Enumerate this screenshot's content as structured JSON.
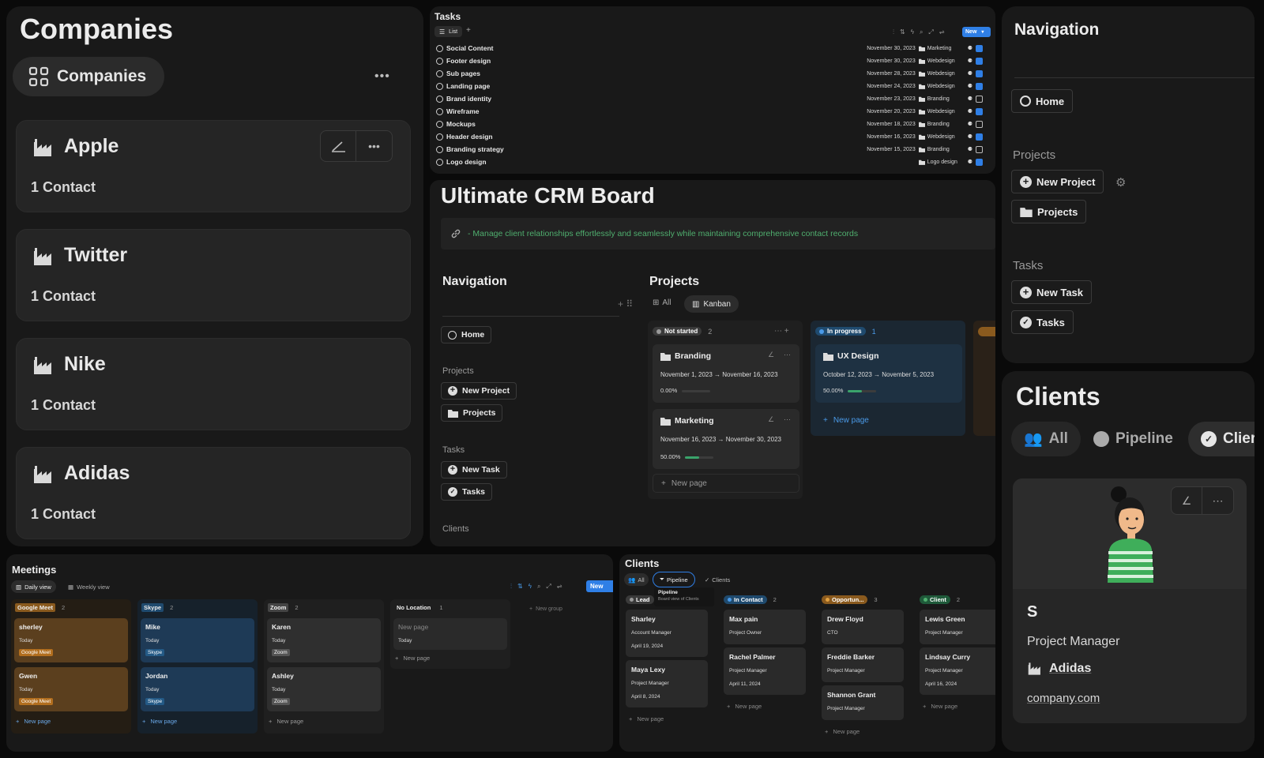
{
  "companies": {
    "title": "Companies",
    "view_tab": "Companies",
    "more": "•••",
    "cards": [
      {
        "name": "Apple",
        "contacts": "1 Contact"
      },
      {
        "name": "Twitter",
        "contacts": "1 Contact"
      },
      {
        "name": "Nike",
        "contacts": "1 Contact"
      },
      {
        "name": "Adidas",
        "contacts": "1 Contact"
      }
    ],
    "card_more": "•••"
  },
  "tasks": {
    "title": "Tasks",
    "view": "List",
    "add": "+",
    "new_btn": "New",
    "rows": [
      {
        "name": "Social Content",
        "date": "November 30, 2023",
        "tag": "Marketing",
        "done": true
      },
      {
        "name": "Footer design",
        "date": "November 30, 2023",
        "tag": "Webdesign",
        "done": true
      },
      {
        "name": "Sub pages",
        "date": "November 28, 2023",
        "tag": "Webdesign",
        "done": true
      },
      {
        "name": "Landing page",
        "date": "November 24, 2023",
        "tag": "Webdesign",
        "done": true
      },
      {
        "name": "Brand identity",
        "date": "November 23, 2023",
        "tag": "Branding",
        "done": false
      },
      {
        "name": "Wireframe",
        "date": "November 20, 2023",
        "tag": "Webdesign",
        "done": true
      },
      {
        "name": "Mockups",
        "date": "November 18, 2023",
        "tag": "Branding",
        "done": false
      },
      {
        "name": "Header design",
        "date": "November 16, 2023",
        "tag": "Webdesign",
        "done": true
      },
      {
        "name": "Branding strategy",
        "date": "November 15, 2023",
        "tag": "Branding",
        "done": false
      },
      {
        "name": "Logo design",
        "date": "",
        "tag": "Logo design",
        "done": true
      }
    ]
  },
  "crm": {
    "title": "Ultimate CRM Board",
    "callout": "- Manage client relationships effortlessly and seamlessly while maintaining comprehensive contact records",
    "nav_title": "Navigation",
    "home": "Home",
    "projects_label": "Projects",
    "new_project": "New Project",
    "projects": "Projects",
    "tasks_label": "Tasks",
    "new_task": "New Task",
    "tasks": "Tasks",
    "clients_label": "Clients",
    "proj_title": "Projects",
    "tab_all": "All",
    "tab_kanban": "Kanban",
    "groups": [
      {
        "label": "Not started",
        "count": "2"
      },
      {
        "label": "In progress",
        "count": "1"
      }
    ],
    "cards": [
      {
        "name": "Branding",
        "dates": "November 1, 2023 → November 16, 2023",
        "pct": "0.00%",
        "progress": 0
      },
      {
        "name": "Marketing",
        "dates": "November 16, 2023 → November 30, 2023",
        "pct": "50.00%",
        "progress": 0.5
      },
      {
        "name": "UX Design",
        "dates": "October 12, 2023 → November 5, 2023",
        "pct": "50.00%",
        "progress": 0.5
      }
    ],
    "new_page": "New page"
  },
  "nav": {
    "title": "Navigation",
    "home": "Home",
    "projects_label": "Projects",
    "new_project": "New Project",
    "projects": "Projects",
    "tasks_label": "Tasks",
    "new_task": "New Task",
    "tasks": "Tasks"
  },
  "clients_panel": {
    "title": "Clients",
    "tab_all": "All",
    "tab_pipeline": "Pipeline",
    "tab_clients": "Clier",
    "initial": "S",
    "role": "Project Manager",
    "company": "Adidas",
    "site": "company.com"
  },
  "meetings": {
    "title": "Meetings",
    "tab_daily": "Daily view",
    "tab_weekly": "Weekly view",
    "new_btn": "New",
    "new_group": "New group",
    "new_page": "New page",
    "cols": [
      {
        "label": "Google Meet",
        "count": "2",
        "cards": [
          {
            "name": "sherley",
            "date": "Today",
            "tag": "Google Meet"
          },
          {
            "name": "Gwen",
            "date": "Today",
            "tag": "Google Meet"
          }
        ]
      },
      {
        "label": "Skype",
        "count": "2",
        "cards": [
          {
            "name": "Mike",
            "date": "Today",
            "tag": "Skype"
          },
          {
            "name": "Jordan",
            "date": "Today",
            "tag": "Skype"
          }
        ]
      },
      {
        "label": "Zoom",
        "count": "2",
        "cards": [
          {
            "name": "Karen",
            "date": "Today",
            "tag": "Zoom"
          },
          {
            "name": "Ashley",
            "date": "Today",
            "tag": "Zoom"
          }
        ]
      },
      {
        "label": "No Location",
        "count": "1",
        "cards": [
          {
            "name": "New page",
            "date": "Today",
            "tag": ""
          }
        ]
      }
    ]
  },
  "pipeline": {
    "title": "Clients",
    "tab_all": "All",
    "tab_pipeline": "Pipeline",
    "tab_clients": "Clients",
    "tooltip_title": "Pipeline",
    "tooltip_sub": "Board view of Clients",
    "new_page": "New page",
    "cols": [
      {
        "label": "Lead",
        "count": "",
        "cards": [
          {
            "name": "Sharley",
            "role": "Account Manager",
            "date": "April 19, 2024"
          },
          {
            "name": "Maya Lexy",
            "role": "Project Manager",
            "date": "April 8, 2024"
          }
        ]
      },
      {
        "label": "In Contact",
        "count": "2",
        "cards": [
          {
            "name": "Max pain",
            "role": "Project Owner",
            "date": ""
          },
          {
            "name": "Rachel Palmer",
            "role": "Project Manager",
            "date": "April 11, 2024"
          }
        ]
      },
      {
        "label": "Opportun...",
        "count": "3",
        "cards": [
          {
            "name": "Drew Floyd",
            "role": "CTO",
            "date": ""
          },
          {
            "name": "Freddie Barker",
            "role": "Project Manager",
            "date": ""
          },
          {
            "name": "Shannon Grant",
            "role": "Project Manager",
            "date": ""
          }
        ]
      },
      {
        "label": "Client",
        "count": "2",
        "cards": [
          {
            "name": "Lewis Green",
            "role": "Project Manager",
            "date": ""
          },
          {
            "name": "Lindsay Curry",
            "role": "Project Manager",
            "date": "April 16, 2024"
          }
        ]
      }
    ]
  },
  "colors": {
    "accent": "#2f7fe6",
    "green_text": "#4fae6e",
    "google": "#8a5a1e",
    "skype": "#1f4a6e",
    "zoom": "#454545"
  }
}
